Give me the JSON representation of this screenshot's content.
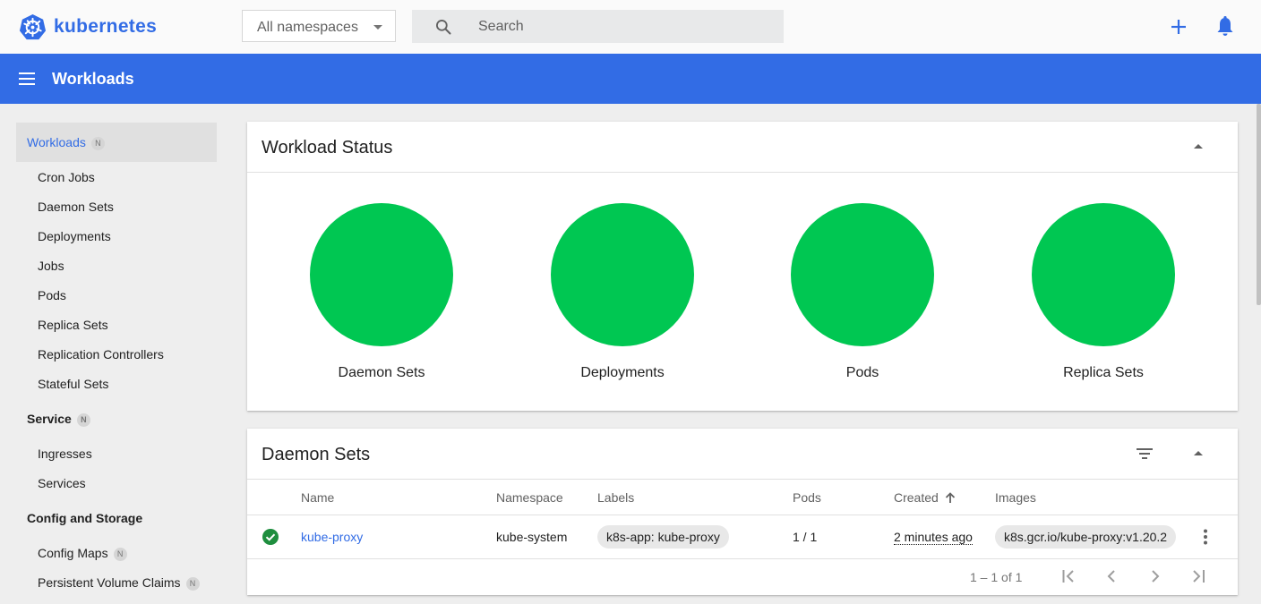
{
  "app": {
    "name": "kubernetes"
  },
  "toolbar": {
    "namespace_value": "All namespaces",
    "search_placeholder": "Search"
  },
  "header": {
    "title": "Workloads"
  },
  "sidebar": {
    "active": {
      "label": "Workloads",
      "badge": "N"
    },
    "workload_items": [
      "Cron Jobs",
      "Daemon Sets",
      "Deployments",
      "Jobs",
      "Pods",
      "Replica Sets",
      "Replication Controllers",
      "Stateful Sets"
    ],
    "service": {
      "label": "Service",
      "badge": "N",
      "items": [
        "Ingresses",
        "Services"
      ]
    },
    "config": {
      "label": "Config and Storage",
      "items": [
        {
          "label": "Config Maps",
          "badge": "N"
        },
        {
          "label": "Persistent Volume Claims",
          "badge": "N"
        }
      ]
    }
  },
  "workload_status": {
    "title": "Workload Status",
    "items": [
      {
        "label": "Daemon Sets",
        "color": "#00c752"
      },
      {
        "label": "Deployments",
        "color": "#00c752"
      },
      {
        "label": "Pods",
        "color": "#00c752"
      },
      {
        "label": "Replica Sets",
        "color": "#00c752"
      }
    ]
  },
  "daemon_sets": {
    "title": "Daemon Sets",
    "columns": [
      "Name",
      "Namespace",
      "Labels",
      "Pods",
      "Created",
      "Images"
    ],
    "rows": [
      {
        "name": "kube-proxy",
        "namespace": "kube-system",
        "labels": "k8s-app: kube-proxy",
        "pods": "1 / 1",
        "created": "2 minutes ago",
        "images": "k8s.gcr.io/kube-proxy:v1.20.2",
        "status": "running"
      }
    ],
    "pagination": "1 – 1 of 1"
  },
  "colors": {
    "brand": "#326ce5",
    "success": "#00c752",
    "status_ok": "#1e8e3e"
  }
}
